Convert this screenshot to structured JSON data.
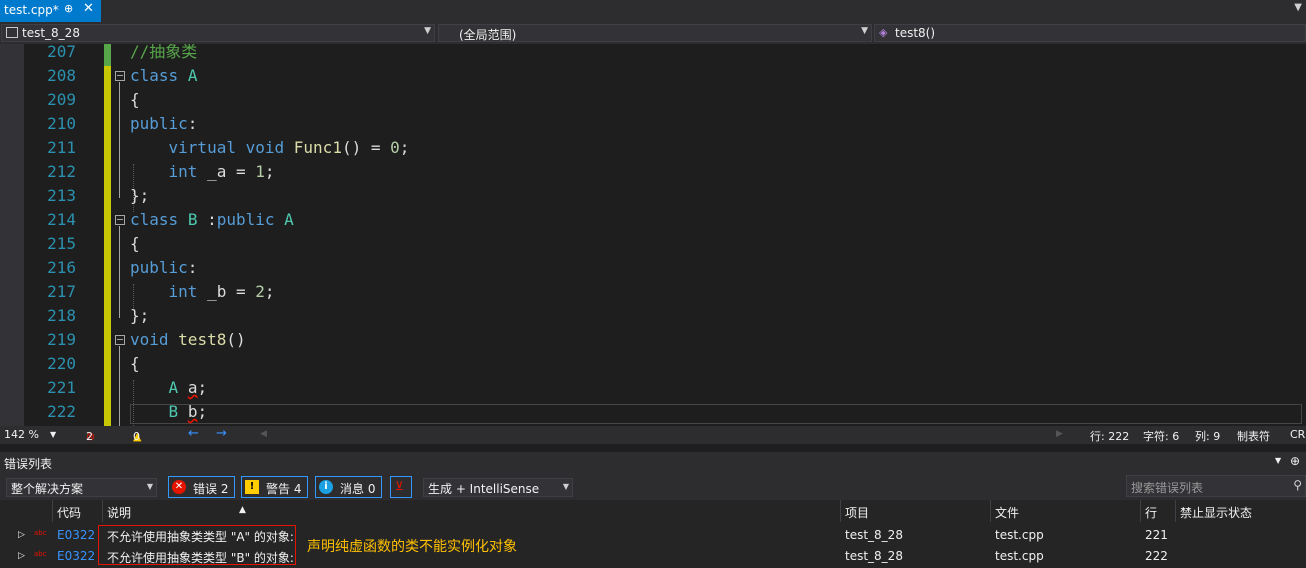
{
  "tab": {
    "title": "test.cpp*",
    "pin": "⊕",
    "close": "✕"
  },
  "nav": {
    "project": "test_8_28",
    "scope": "(全局范围)",
    "member": "test8()"
  },
  "code_lines": [
    {
      "n": "207",
      "tokens": [
        [
          "cm",
          "//抽象类"
        ]
      ]
    },
    {
      "n": "208",
      "tokens": [
        [
          "kw",
          "class"
        ],
        [
          "id",
          " "
        ],
        [
          "ty",
          "A"
        ]
      ]
    },
    {
      "n": "209",
      "tokens": [
        [
          "id",
          "{"
        ]
      ]
    },
    {
      "n": "210",
      "tokens": [
        [
          "kw",
          "public"
        ],
        [
          "id",
          ":"
        ]
      ]
    },
    {
      "n": "211",
      "tokens": [
        [
          "id",
          "    "
        ],
        [
          "kw",
          "virtual"
        ],
        [
          "id",
          " "
        ],
        [
          "kw",
          "void"
        ],
        [
          "id",
          " "
        ],
        [
          "fn",
          "Func1"
        ],
        [
          "id",
          "() = "
        ],
        [
          "num",
          "0"
        ],
        [
          "id",
          ";"
        ]
      ]
    },
    {
      "n": "212",
      "tokens": [
        [
          "id",
          "    "
        ],
        [
          "kw",
          "int"
        ],
        [
          "id",
          " _a = "
        ],
        [
          "num",
          "1"
        ],
        [
          "id",
          ";"
        ]
      ]
    },
    {
      "n": "213",
      "tokens": [
        [
          "id",
          "};"
        ]
      ]
    },
    {
      "n": "214",
      "tokens": [
        [
          "kw",
          "class"
        ],
        [
          "id",
          " "
        ],
        [
          "ty",
          "B"
        ],
        [
          "id",
          " :"
        ],
        [
          "kw",
          "public"
        ],
        [
          "id",
          " "
        ],
        [
          "ty",
          "A"
        ]
      ]
    },
    {
      "n": "215",
      "tokens": [
        [
          "id",
          "{"
        ]
      ]
    },
    {
      "n": "216",
      "tokens": [
        [
          "kw",
          "public"
        ],
        [
          "id",
          ":"
        ]
      ]
    },
    {
      "n": "217",
      "tokens": [
        [
          "id",
          "    "
        ],
        [
          "kw",
          "int"
        ],
        [
          "id",
          " _b = "
        ],
        [
          "num",
          "2"
        ],
        [
          "id",
          ";"
        ]
      ]
    },
    {
      "n": "218",
      "tokens": [
        [
          "id",
          "};"
        ]
      ]
    },
    {
      "n": "219",
      "tokens": [
        [
          "kw",
          "void"
        ],
        [
          "id",
          " "
        ],
        [
          "fn",
          "test8"
        ],
        [
          "id",
          "()"
        ]
      ]
    },
    {
      "n": "220",
      "tokens": [
        [
          "id",
          "{"
        ]
      ]
    },
    {
      "n": "221",
      "tokens": [
        [
          "id",
          "    "
        ],
        [
          "ty",
          "A"
        ],
        [
          "id",
          " "
        ],
        [
          "sq",
          "a"
        ],
        [
          "id",
          ";"
        ]
      ]
    },
    {
      "n": "222",
      "tokens": [
        [
          "id",
          "    "
        ],
        [
          "ty",
          "B"
        ],
        [
          "id",
          " "
        ],
        [
          "sq",
          "b"
        ],
        [
          "id",
          ";"
        ]
      ]
    }
  ],
  "editor_status": {
    "zoom": "142 %",
    "errors": "2",
    "warnings": "0",
    "row": "行: 222",
    "char": "字符: 6",
    "col": "列: 9",
    "tabs": "制表符",
    "eol": "CRLF"
  },
  "error_list": {
    "title": "错误列表",
    "scope": "整个解决方案",
    "errors_btn": "错误 2",
    "warnings_btn": "警告 4",
    "messages_btn": "消息 0",
    "source": "生成 + IntelliSense",
    "search_placeholder": "搜索错误列表",
    "columns": {
      "code": "代码",
      "desc": "说明",
      "project": "项目",
      "file": "文件",
      "line": "行",
      "suppress": "禁止显示状态"
    },
    "rows": [
      {
        "code": "E0322",
        "desc": "不允许使用抽象类类型 \"A\" 的对象:",
        "project": "test_8_28",
        "file": "test.cpp",
        "line": "221"
      },
      {
        "code": "E0322",
        "desc": "不允许使用抽象类类型 \"B\" 的对象:",
        "project": "test_8_28",
        "file": "test.cpp",
        "line": "222"
      }
    ]
  },
  "annotation": "声明纯虚函数的类不能实例化对象",
  "colors": {
    "accent": "#007acc",
    "annotation": "#ffc000",
    "error": "#e51400"
  }
}
